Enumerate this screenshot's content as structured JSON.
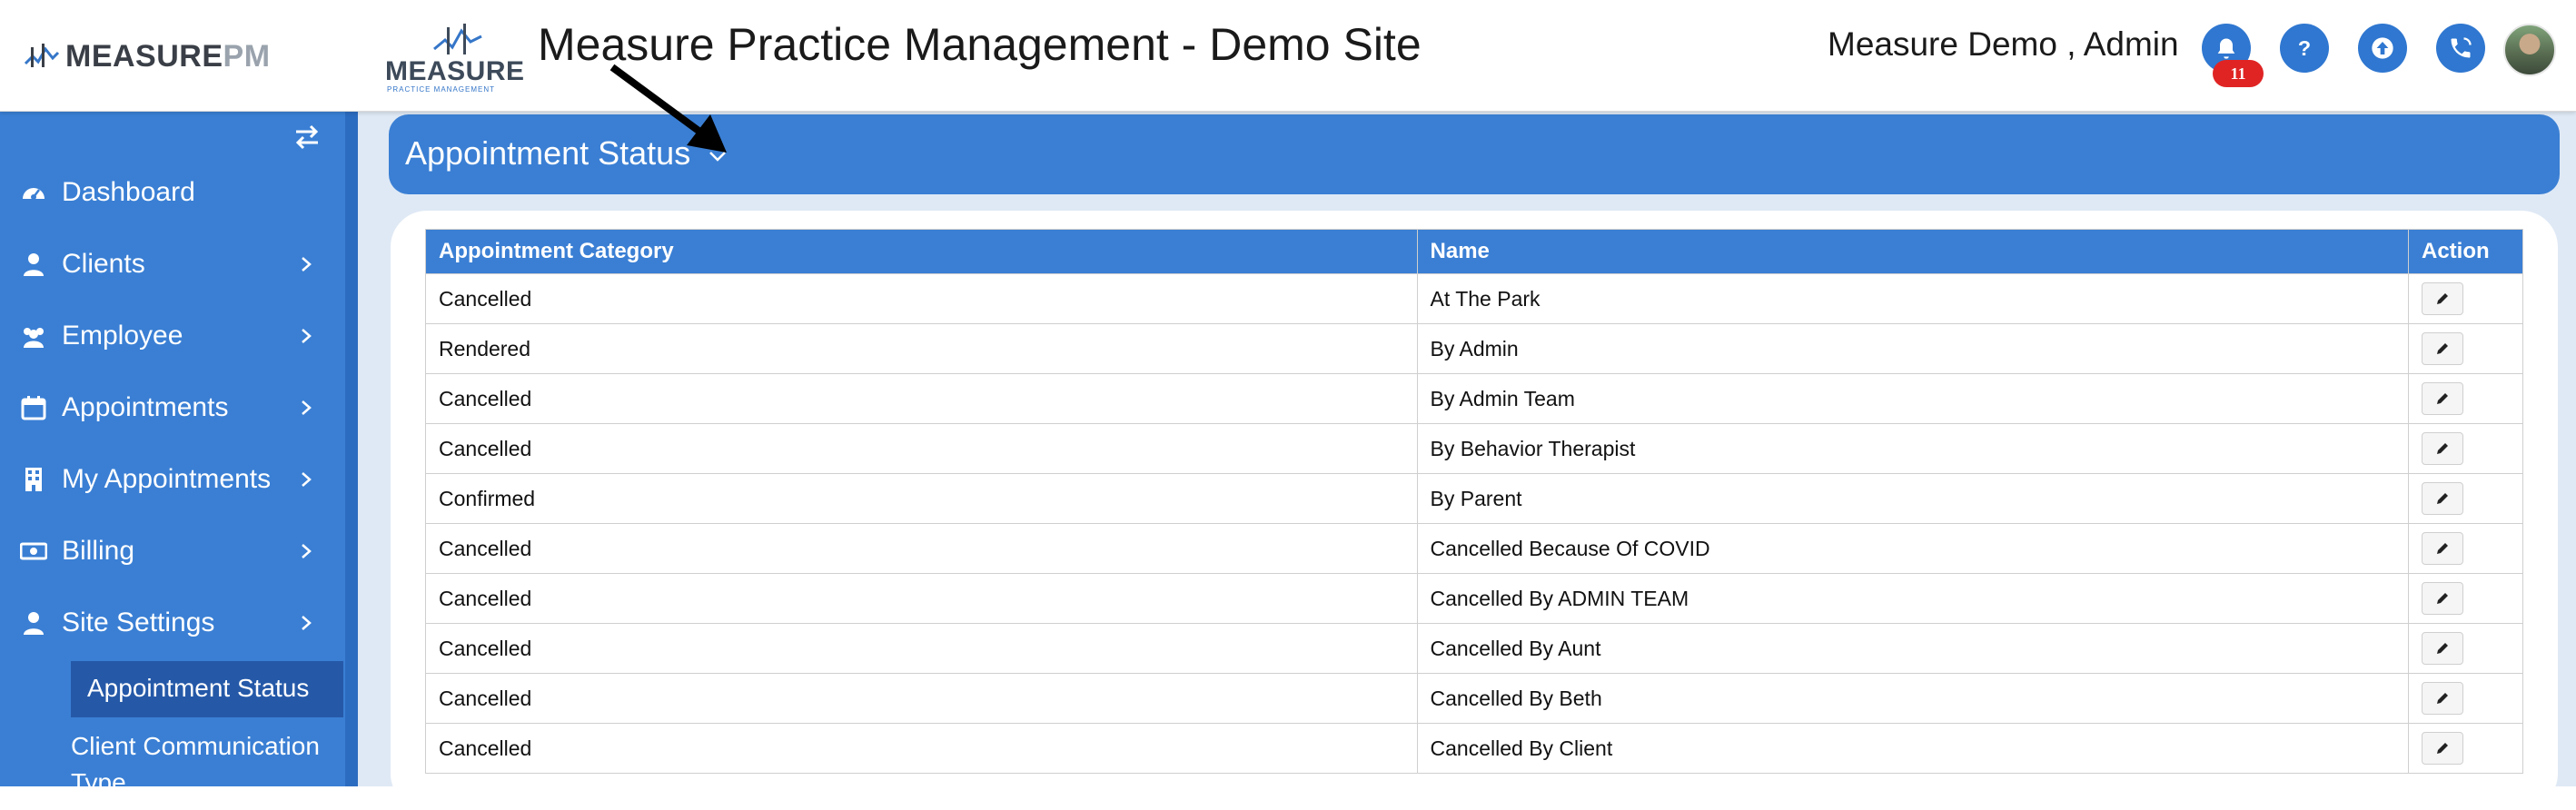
{
  "header": {
    "brand_left_main": "MEASURE",
    "brand_left_accent": "PM",
    "brand_right_word": "MEASURE",
    "brand_right_sub": "PRACTICE MANAGEMENT",
    "title": "Measure Practice Management - Demo Site",
    "user": "Measure Demo , Admin",
    "notification_count": "11",
    "icons": [
      "bell-icon",
      "help-icon",
      "upload-icon",
      "phone-icon"
    ],
    "accent_color": "#2f77d0"
  },
  "sidebar": {
    "items": [
      {
        "label": "Dashboard",
        "icon": "dashboard-icon",
        "has_children": false
      },
      {
        "label": "Clients",
        "icon": "user-icon",
        "has_children": true
      },
      {
        "label": "Employee",
        "icon": "users-icon",
        "has_children": true
      },
      {
        "label": "Appointments",
        "icon": "calendar-icon",
        "has_children": true
      },
      {
        "label": "My Appointments",
        "icon": "building-icon",
        "has_children": true
      },
      {
        "label": "Billing",
        "icon": "money-icon",
        "has_children": true
      },
      {
        "label": "Site Settings",
        "icon": "user-icon",
        "has_children": true
      }
    ],
    "sub_items": [
      {
        "label": "Appointment Status",
        "active": true
      },
      {
        "label": "Client Communication Type",
        "active": false
      }
    ],
    "background": "#3a7fd4"
  },
  "page": {
    "title": "Appointment Status"
  },
  "table": {
    "columns": [
      "Appointment Category",
      "Name",
      "Action"
    ],
    "rows": [
      {
        "category": "Cancelled",
        "name": "At The Park"
      },
      {
        "category": "Rendered",
        "name": "By Admin"
      },
      {
        "category": "Cancelled",
        "name": "By Admin Team"
      },
      {
        "category": "Cancelled",
        "name": "By Behavior Therapist"
      },
      {
        "category": "Confirmed",
        "name": "By Parent"
      },
      {
        "category": "Cancelled",
        "name": "Cancelled Because Of COVID"
      },
      {
        "category": "Cancelled",
        "name": "Cancelled By ADMIN TEAM"
      },
      {
        "category": "Cancelled",
        "name": "Cancelled By Aunt"
      },
      {
        "category": "Cancelled",
        "name": "Cancelled By Beth"
      },
      {
        "category": "Cancelled",
        "name": "Cancelled By Client"
      }
    ]
  }
}
